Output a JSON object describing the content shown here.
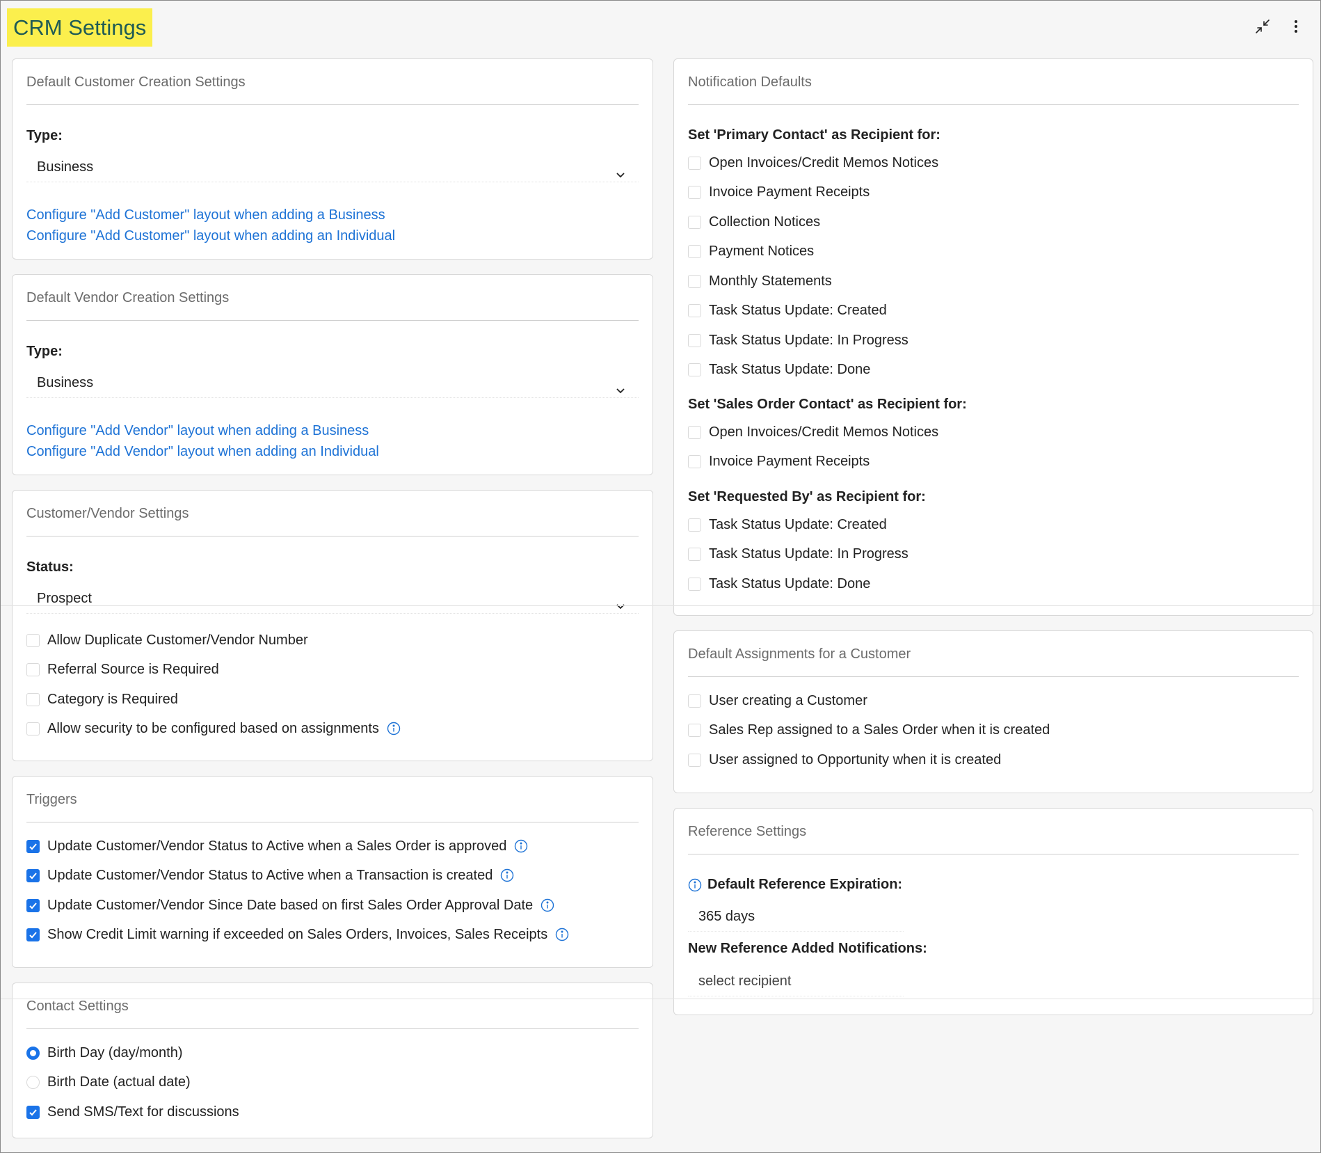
{
  "header": {
    "title": "CRM Settings",
    "highlight_color": "#fbef4d",
    "collapse_icon": "collapse-arrows-icon",
    "menu_icon": "vertical-ellipsis-icon"
  },
  "accent_color": "#1a73e8",
  "link_color": "#1e73d6",
  "customer_creation": {
    "title": "Default Customer Creation Settings",
    "type_label": "Type:",
    "type_value": "Business",
    "link_business": "Configure \"Add Customer\" layout when adding a Business",
    "link_individual": "Configure \"Add Customer\" layout when adding an Individual"
  },
  "vendor_creation": {
    "title": "Default Vendor Creation Settings",
    "type_label": "Type:",
    "type_value": "Business",
    "link_business": "Configure \"Add Vendor\" layout when adding a Business",
    "link_individual": "Configure \"Add Vendor\" layout when adding an Individual"
  },
  "customer_vendor": {
    "title": "Customer/Vendor Settings",
    "status_label": "Status:",
    "status_value": "Prospect",
    "options": [
      {
        "label": "Allow Duplicate Customer/Vendor Number",
        "checked": false
      },
      {
        "label": "Referral Source is Required",
        "checked": false
      },
      {
        "label": "Category is Required",
        "checked": false
      },
      {
        "label": "Allow security to be configured based on assignments",
        "checked": false,
        "info": true
      }
    ]
  },
  "triggers": {
    "title": "Triggers",
    "options": [
      {
        "label": "Update Customer/Vendor Status to Active when a Sales Order is approved",
        "checked": true,
        "info": true
      },
      {
        "label": "Update Customer/Vendor Status to Active when a Transaction is created",
        "checked": true,
        "info": true
      },
      {
        "label": "Update Customer/Vendor Since Date based on first Sales Order Approval Date",
        "checked": true,
        "info": true
      },
      {
        "label": "Show Credit Limit warning if exceeded on Sales Orders, Invoices, Sales Receipts",
        "checked": true,
        "info": true
      }
    ]
  },
  "contact": {
    "title": "Contact Settings",
    "radio_birth_day": "Birth Day (day/month)",
    "radio_birth_date": "Birth Date (actual date)",
    "birth_selected": "day",
    "sms_label": "Send SMS/Text for discussions",
    "sms_checked": true
  },
  "notifications": {
    "title": "Notification Defaults",
    "primary_head": "Set 'Primary Contact' as Recipient for:",
    "primary_items": [
      "Open Invoices/Credit Memos Notices",
      "Invoice Payment Receipts",
      "Collection Notices",
      "Payment Notices",
      "Monthly Statements",
      "Task Status Update: Created",
      "Task Status Update: In Progress",
      "Task Status Update: Done"
    ],
    "sales_head": "Set 'Sales Order Contact' as Recipient for:",
    "sales_items": [
      "Open Invoices/Credit Memos Notices",
      "Invoice Payment Receipts"
    ],
    "requested_head": "Set 'Requested By' as Recipient for:",
    "requested_items": [
      "Task Status Update: Created",
      "Task Status Update: In Progress",
      "Task Status Update: Done"
    ]
  },
  "assignments": {
    "title": "Default Assignments for a Customer",
    "items": [
      "User creating a Customer",
      "Sales Rep assigned to a Sales Order when it is created",
      "User assigned to Opportunity when it is created"
    ]
  },
  "reference": {
    "title": "Reference Settings",
    "expiration_label": "Default Reference Expiration:",
    "expiration_value": "365 days",
    "notif_label": "New Reference Added Notifications:",
    "notif_value": "select recipient"
  }
}
